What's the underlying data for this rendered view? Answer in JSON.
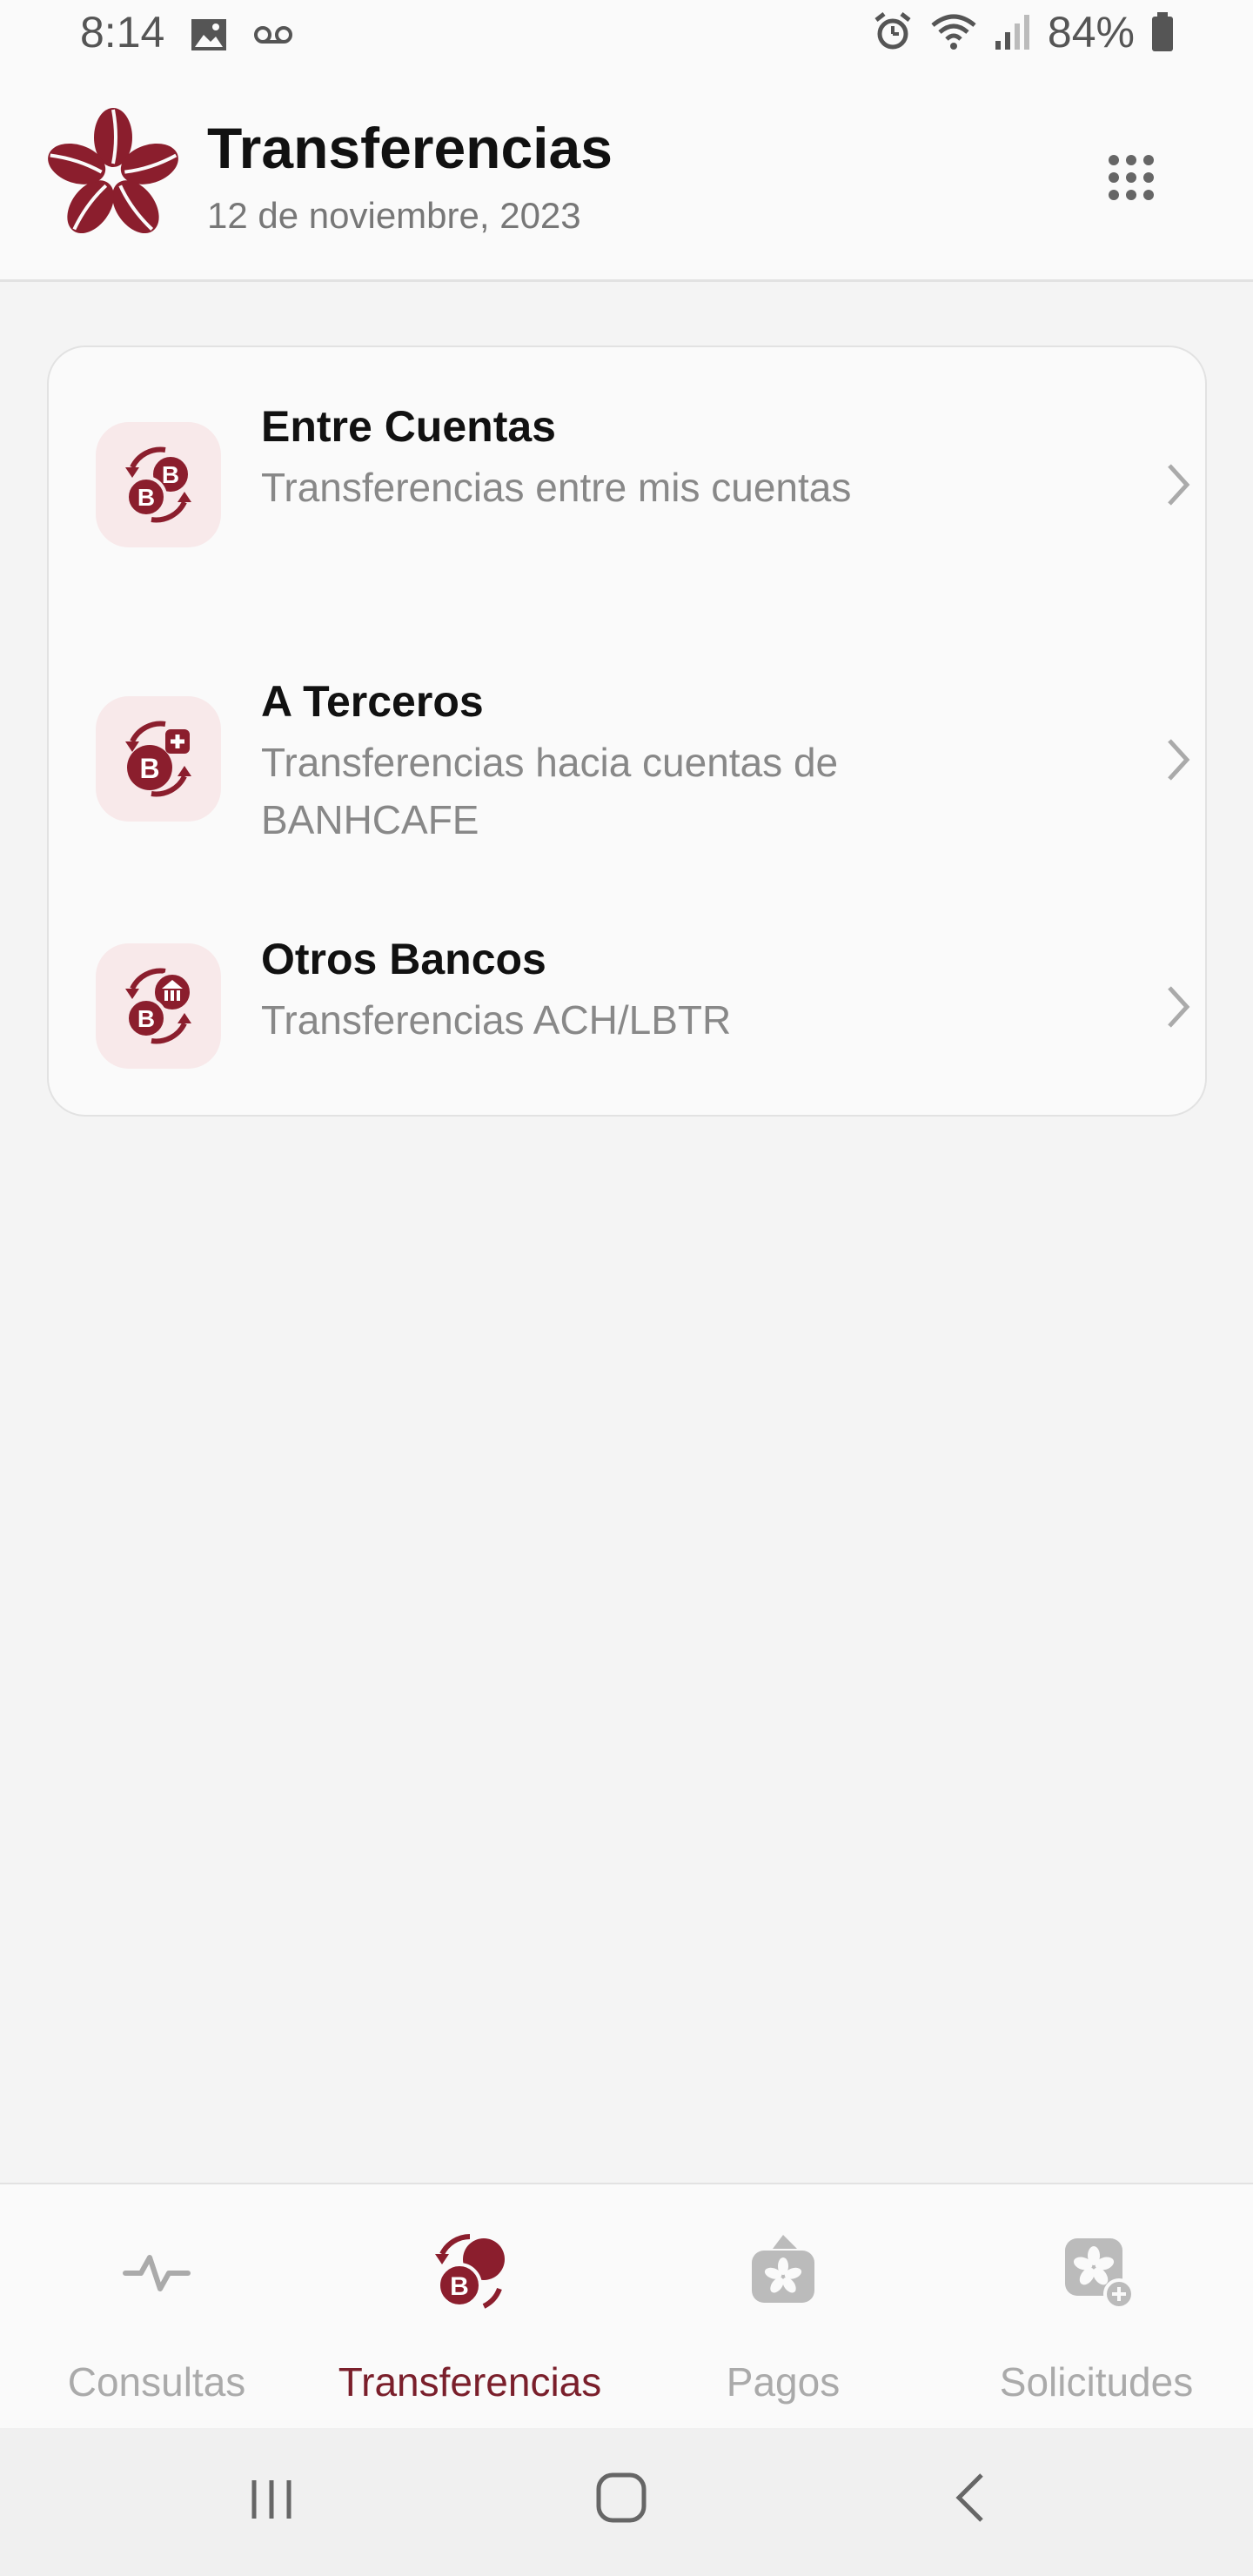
{
  "status_bar": {
    "time": "8:14",
    "battery": "84%",
    "left_icons": [
      "image-icon",
      "voicemail-icon"
    ],
    "right_icons": [
      "alarm-icon",
      "wifi-icon",
      "signal-icon",
      "battery-icon"
    ]
  },
  "header": {
    "title": "Transferencias",
    "date": "12 de noviembre, 2023",
    "logo": "banhcafe-logo",
    "menu_icon": "apps-grid-icon"
  },
  "options": [
    {
      "title": "Entre Cuentas",
      "description": "Transferencias entre mis cuentas",
      "icon": "transfer-own-accounts-icon"
    },
    {
      "title": "A Terceros",
      "description": "Transferencias hacia cuentas de BANHCAFE",
      "icon": "transfer-third-party-icon"
    },
    {
      "title": "Otros Bancos",
      "description": "Transferencias ACH/LBTR",
      "icon": "transfer-other-banks-icon"
    }
  ],
  "bottom_nav": [
    {
      "label": "Consultas",
      "icon": "activity-icon",
      "active": false
    },
    {
      "label": "Transferencias",
      "icon": "transfer-icon",
      "active": true
    },
    {
      "label": "Pagos",
      "icon": "payments-icon",
      "active": false
    },
    {
      "label": "Solicitudes",
      "icon": "requests-icon",
      "active": false
    }
  ],
  "colors": {
    "brand": "#8b1e2d",
    "brand_light": "#f8e9ea",
    "inactive": "#aaaaaa"
  }
}
